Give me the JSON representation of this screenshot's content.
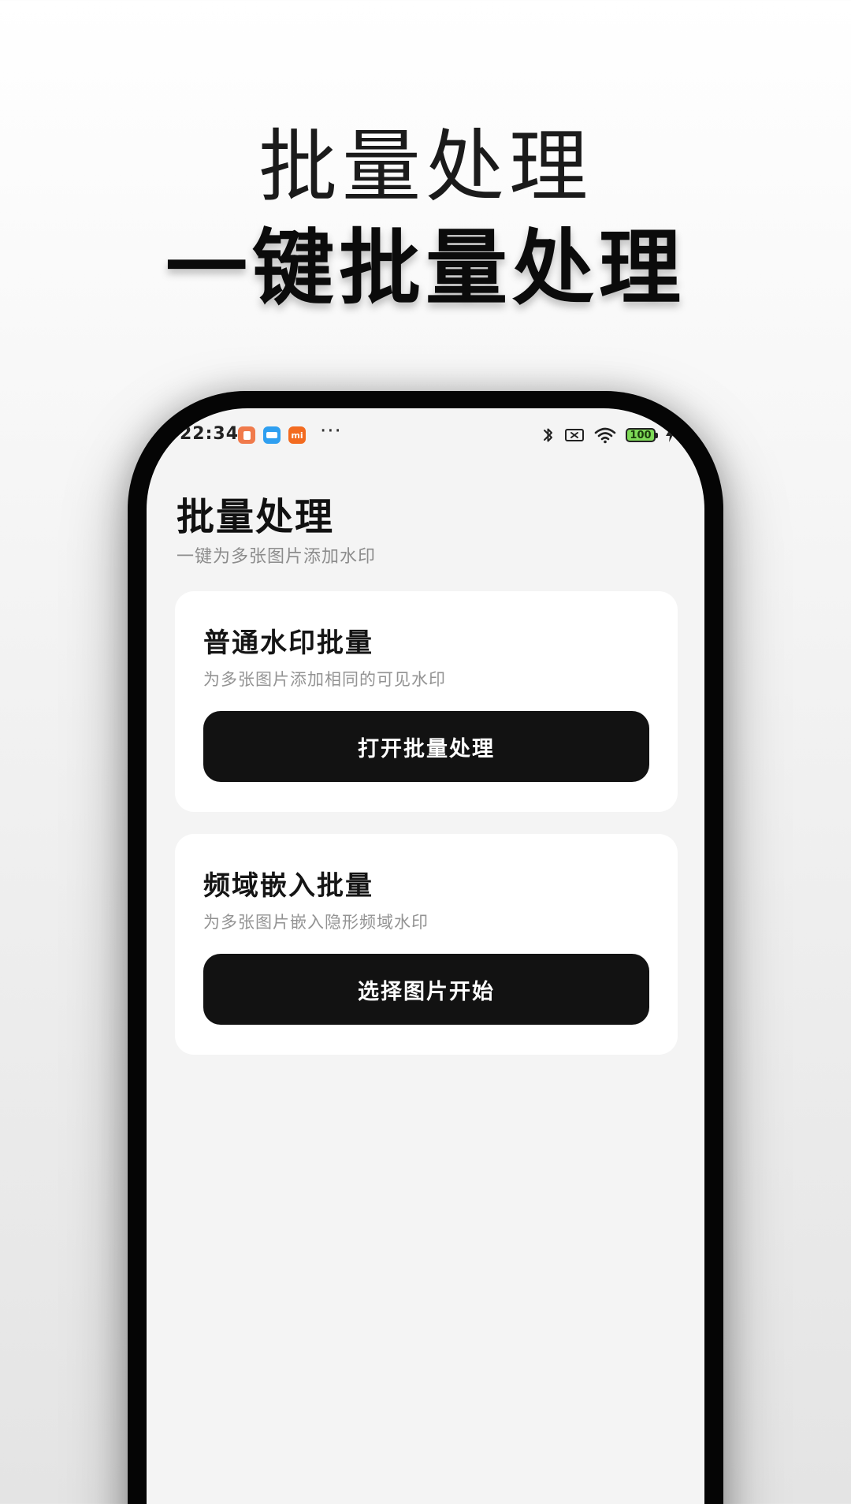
{
  "promo": {
    "title": "批量处理",
    "headline": "一键批量处理"
  },
  "status_bar": {
    "time": "22:34",
    "icons": [
      "app-notification-icon",
      "message-icon",
      "mi-icon"
    ],
    "mi_label": "mi",
    "more": "···",
    "battery": "100",
    "right_icons": [
      "bluetooth-icon",
      "no-sim-icon",
      "wifi-icon",
      "battery-icon",
      "charging-icon"
    ]
  },
  "page": {
    "title": "批量处理",
    "subtitle": "一键为多张图片添加水印"
  },
  "cards": [
    {
      "title": "普通水印批量",
      "description": "为多张图片添加相同的可见水印",
      "button_label": "打开批量处理"
    },
    {
      "title": "频域嵌入批量",
      "description": "为多张图片嵌入隐形频域水印",
      "button_label": "选择图片开始"
    }
  ],
  "colors": {
    "button_bg": "#121212",
    "screen_bg": "#f4f4f4",
    "card_bg": "#ffffff",
    "battery_fill": "#7dd957"
  }
}
